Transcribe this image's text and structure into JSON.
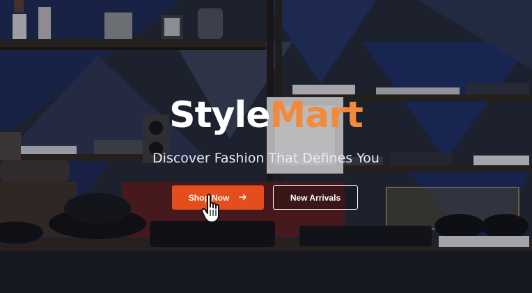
{
  "hero": {
    "brand_part1": "Style",
    "brand_part2": "Mart",
    "tagline": "Discover Fashion That Defines You",
    "primary_cta": "Shop Now",
    "secondary_cta": "New Arrivals"
  },
  "icons": {
    "primary_arrow": "arrow-right-icon",
    "cursor": "hand-pointer-icon"
  },
  "colors": {
    "brand_accent": "#f28a3c",
    "primary_button": "#e34e1c",
    "text_white": "#ffffff"
  }
}
